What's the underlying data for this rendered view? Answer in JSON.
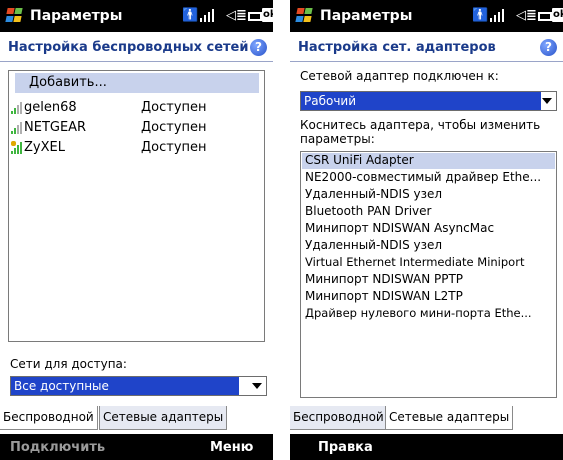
{
  "colors": {
    "titlebar_bg": "#000000",
    "heading_text": "#1a3a8a",
    "selection": "#1f44c9",
    "list_highlight": "#c8d2ec"
  },
  "left": {
    "titlebar": {
      "title": "Параметры",
      "icons": [
        "windows-logo-icon",
        "person-icon",
        "signal-icon",
        "volume-icon",
        "battery-icon",
        "ok-icon"
      ],
      "ok_label": "ok"
    },
    "heading": "Настройка беспроводных сетей",
    "help_glyph": "?",
    "networks": {
      "add_label": "Добавить...",
      "items": [
        {
          "name": "gelen68",
          "status": "Доступен",
          "icon": "wifi-signal-icon",
          "color": "#3fb53f"
        },
        {
          "name": "NETGEAR",
          "status": "Доступен",
          "icon": "wifi-signal-icon",
          "color": "#3fb53f"
        },
        {
          "name": "ZyXEL",
          "status": "Доступен",
          "icon": "wifi-signal-locked-icon",
          "color": "#e0a800"
        }
      ]
    },
    "access_label": "Сети для доступа:",
    "access_value": "Все доступные",
    "tabs": [
      "Беспроводной",
      "Сетевые адаптеры"
    ],
    "active_tab": "Беспроводной",
    "softkeys": {
      "left": "Подключить",
      "right": "Меню"
    }
  },
  "right": {
    "titlebar": {
      "title": "Параметры",
      "ok_label": "ok"
    },
    "heading": "Настройка сет. адаптеров",
    "help_glyph": "?",
    "connected_label": "Сетевой адаптер подключен к:",
    "connected_value": "Рабочий",
    "instruction": "Коснитесь адаптера, чтобы изменить параметры:",
    "adapters": [
      "CSR UniFi Adapter",
      "NE2000-совместимый драйвер Ethe...",
      "Удаленный-NDIS узел",
      "Bluetooth PAN Driver",
      "Минипорт NDISWAN AsyncMac",
      "Удаленный-NDIS узел",
      "Virtual Ethernet Intermediate Miniport",
      "Минипорт NDISWAN PPTP",
      "Минипорт NDISWAN L2TP",
      "Драйвер нулевого мини-порта Ethe..."
    ],
    "tabs": [
      "Беспроводной",
      "Сетевые адаптеры"
    ],
    "active_tab": "Сетевые адаптеры",
    "softkeys": {
      "left": "Правка"
    }
  }
}
